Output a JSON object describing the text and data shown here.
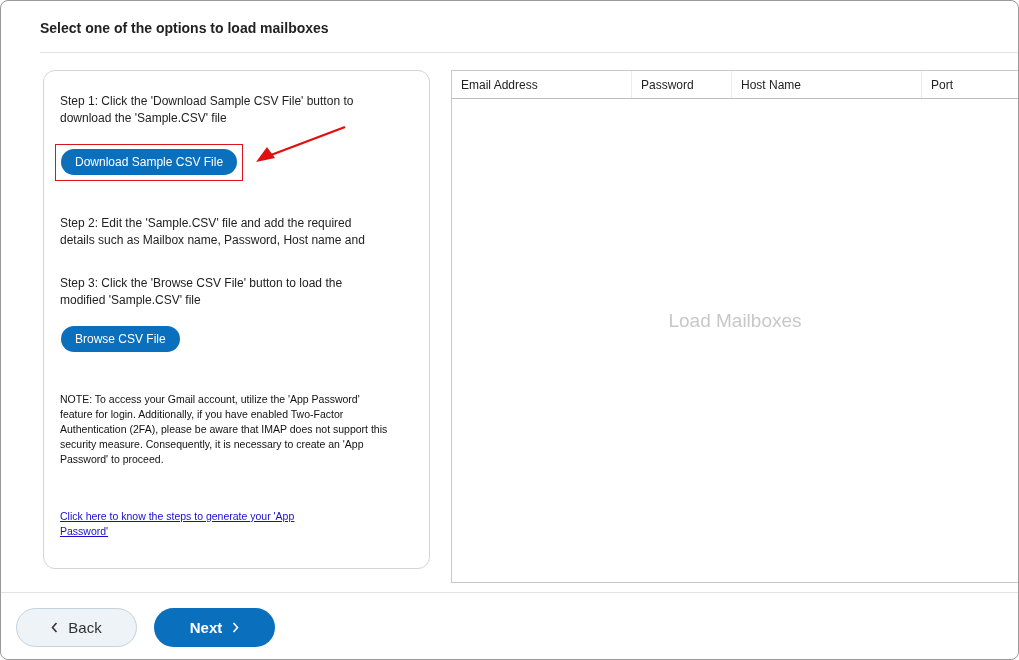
{
  "title": "Select one of the options to load mailboxes",
  "steps": [
    {
      "text": "Step 1: Click the 'Download Sample CSV File' button to download the 'Sample.CSV' file",
      "button": "Download Sample CSV File",
      "highlighted": true
    },
    {
      "text": "Step 2: Edit the 'Sample.CSV' file and add the required details such as Mailbox name, Password, Host name and"
    },
    {
      "text": "Step 3: Click the 'Browse CSV File' button to load the modified 'Sample.CSV' file",
      "button": "Browse CSV File",
      "highlighted": false
    }
  ],
  "note": "NOTE: To access your Gmail account, utilize the 'App Password' feature for login. Additionally, if you have enabled Two-Factor Authentication (2FA), please be aware that IMAP does not support this security measure. Consequently, it is necessary to create an 'App Password' to proceed.",
  "link": "Click here to know the steps to generate your 'App Password'",
  "table": {
    "columns": [
      "Email Address",
      "Password",
      "Host Name",
      "Port"
    ],
    "empty_text": "Load Mailboxes"
  },
  "footer": {
    "back": "Back",
    "next": "Next"
  }
}
